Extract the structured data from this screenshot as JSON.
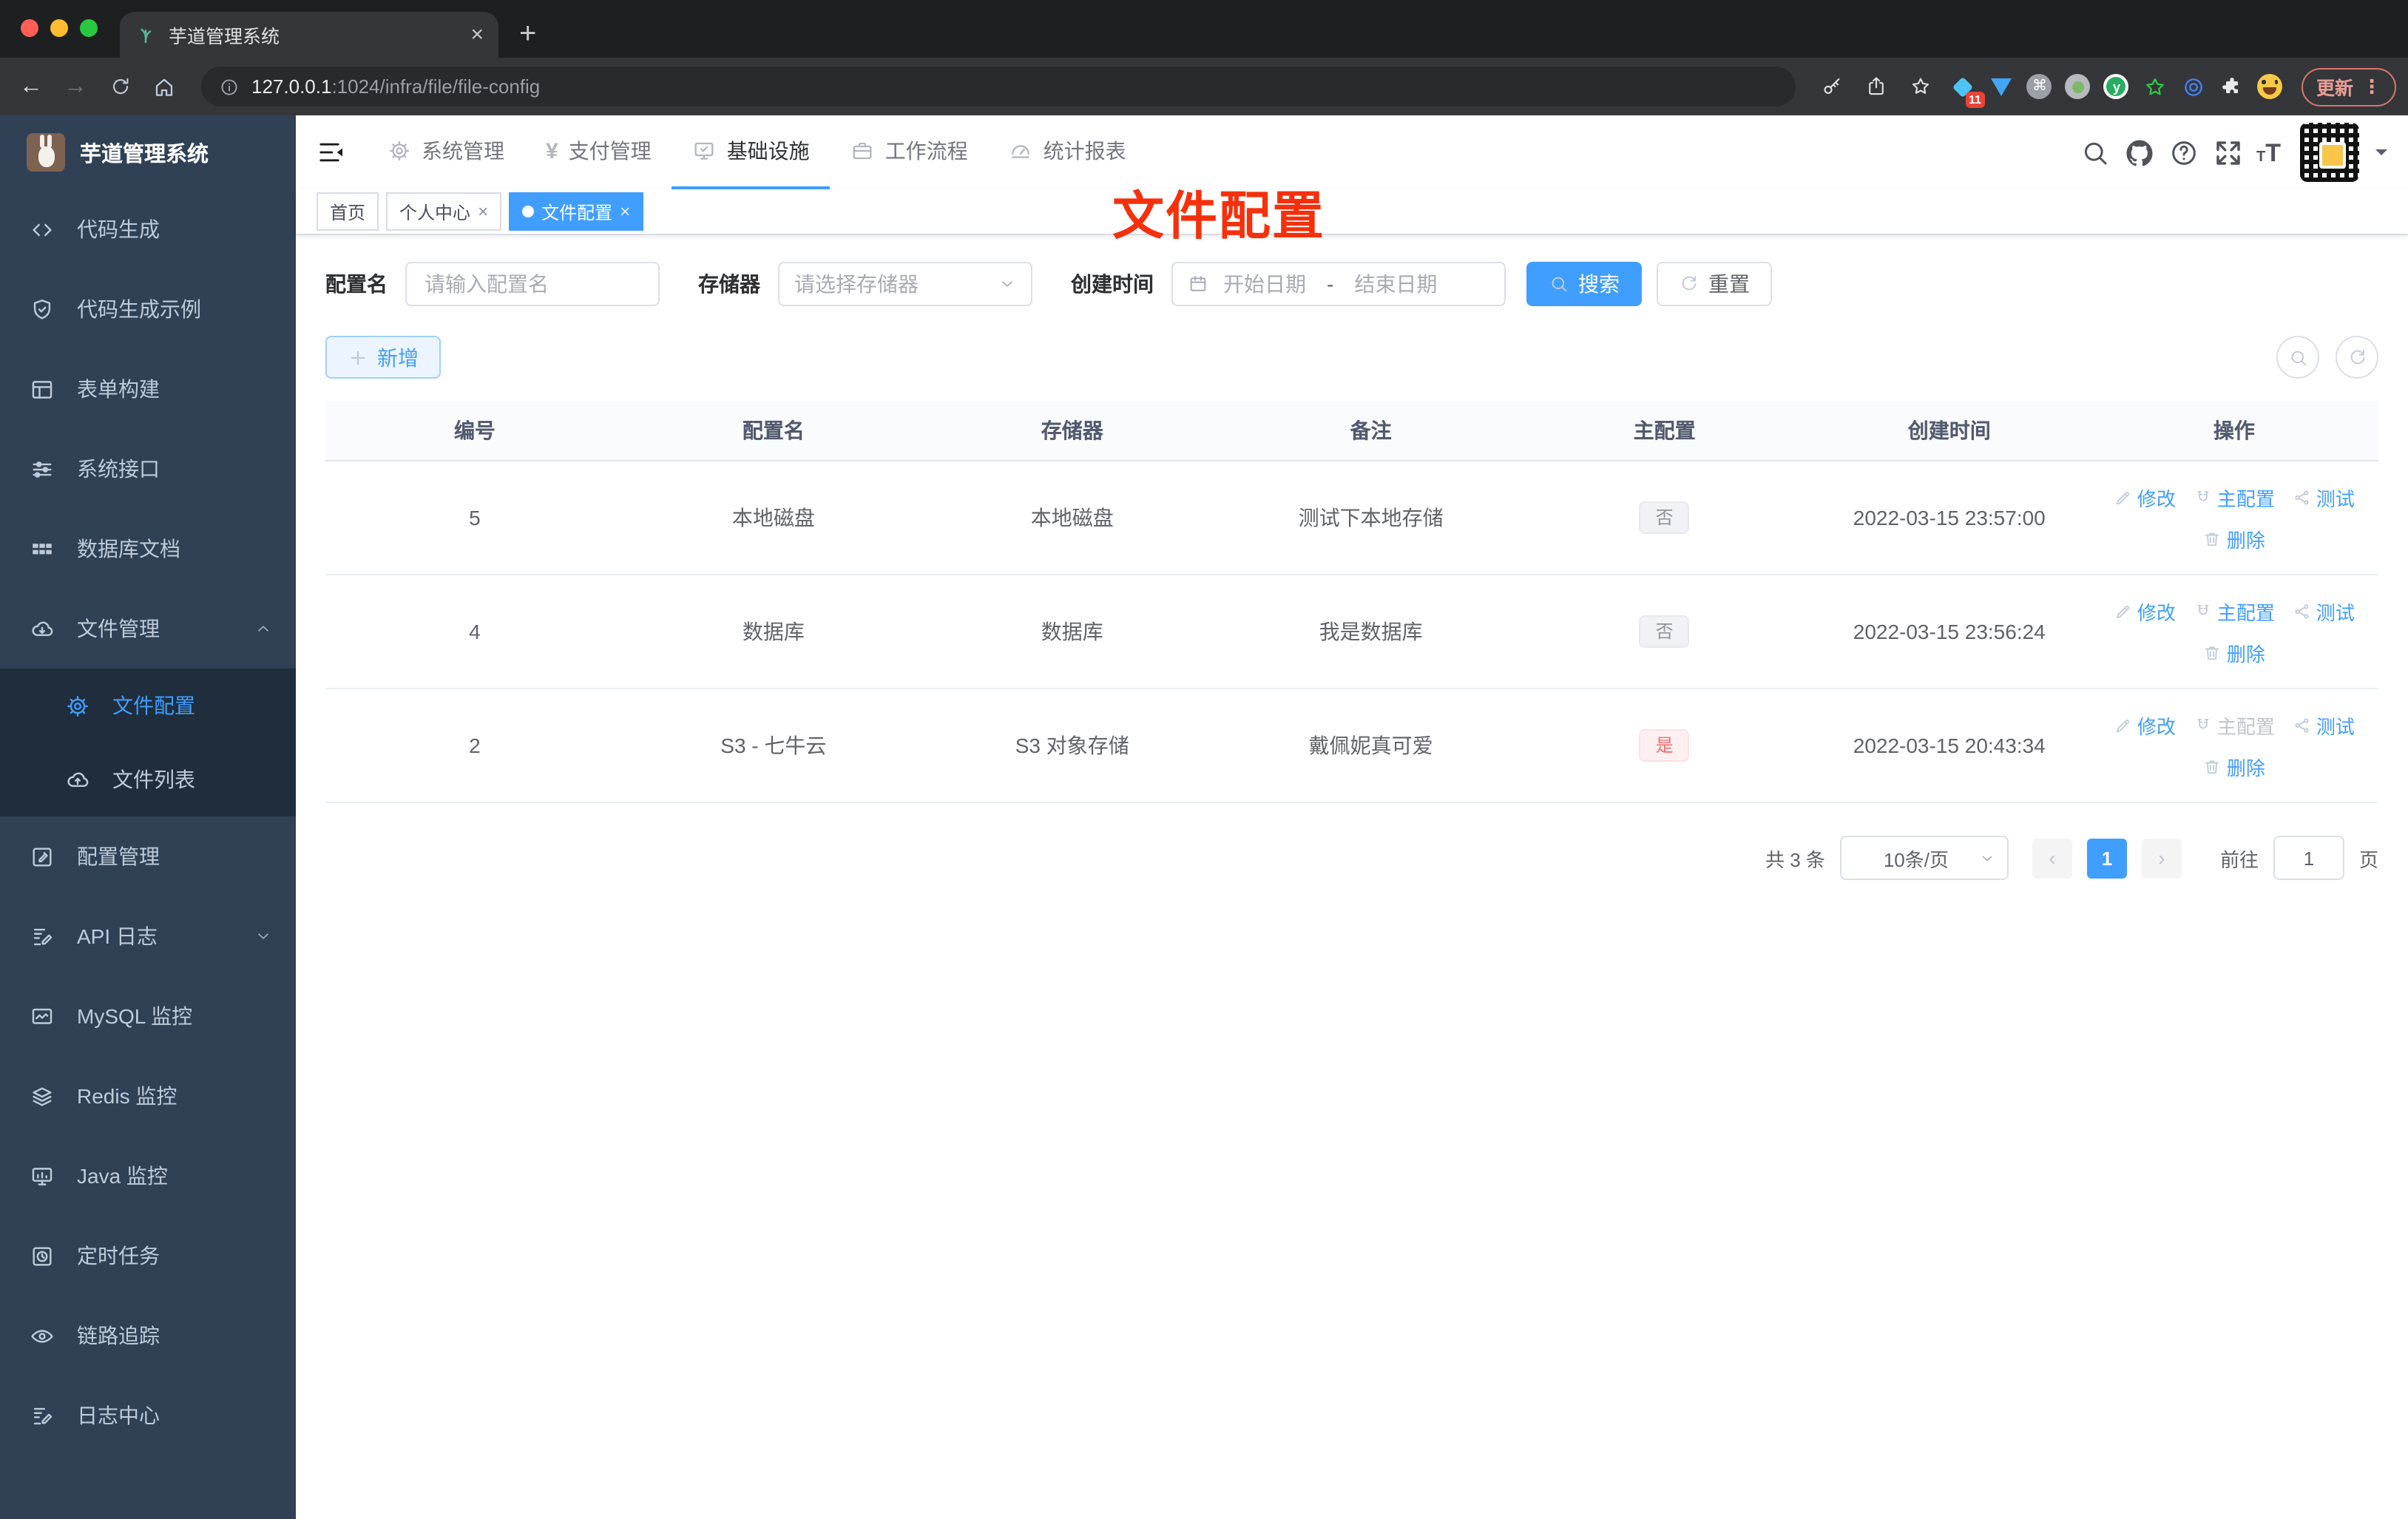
{
  "browser": {
    "tab_title": "芋道管理系统",
    "new_tab_label": "+",
    "url_host": "127.0.0.1",
    "url_path": ":1024/infra/file/file-config",
    "update_label": "更新",
    "extension_badge": "11",
    "traffic_lights": [
      "#ff5f57",
      "#febc2e",
      "#28c840"
    ]
  },
  "sidebar": {
    "title": "芋道管理系统",
    "items": [
      {
        "label": "代码生成",
        "icon": "code-icon"
      },
      {
        "label": "代码生成示例",
        "icon": "shield-check-icon"
      },
      {
        "label": "表单构建",
        "icon": "form-icon"
      },
      {
        "label": "系统接口",
        "icon": "sliders-icon"
      },
      {
        "label": "数据库文档",
        "icon": "grid-icon"
      },
      {
        "label": "文件管理",
        "icon": "cloud-download-icon",
        "expanded": true,
        "children": [
          {
            "label": "文件配置",
            "icon": "gear-icon",
            "active": true
          },
          {
            "label": "文件列表",
            "icon": "cloud-upload-icon"
          }
        ]
      },
      {
        "label": "配置管理",
        "icon": "edit-square-icon"
      },
      {
        "label": "API 日志",
        "icon": "doc-edit-icon",
        "collapsed": true
      },
      {
        "label": "MySQL 监控",
        "icon": "chart-icon"
      },
      {
        "label": "Redis 监控",
        "icon": "layers-icon"
      },
      {
        "label": "Java 监控",
        "icon": "monitor-icon"
      },
      {
        "label": "定时任务",
        "icon": "timer-icon"
      },
      {
        "label": "链路追踪",
        "icon": "eye-icon"
      },
      {
        "label": "日志中心",
        "icon": "doc-edit-icon"
      }
    ]
  },
  "header": {
    "nav": [
      {
        "label": "系统管理",
        "icon": "gear-icon"
      },
      {
        "label": "支付管理",
        "icon": "yen-icon"
      },
      {
        "label": "基础设施",
        "icon": "monitor-check-icon",
        "active": true
      },
      {
        "label": "工作流程",
        "icon": "briefcase-icon"
      },
      {
        "label": "统计报表",
        "icon": "gauge-icon"
      }
    ],
    "tools": [
      "search-icon",
      "github-icon",
      "help-icon",
      "fullscreen-icon",
      "font-size-icon",
      "avatar-qr",
      "caret-down-icon"
    ]
  },
  "tags": [
    {
      "label": "首页"
    },
    {
      "label": "个人中心",
      "closable": true
    },
    {
      "label": "文件配置",
      "active": true,
      "closable": true
    }
  ],
  "annotation": {
    "text": "文件配置",
    "color": "#f6300c"
  },
  "filters": {
    "name_label": "配置名",
    "name_placeholder": "请输入配置名",
    "storage_label": "存储器",
    "storage_placeholder": "请选择存储器",
    "time_label": "创建时间",
    "start_placeholder": "开始日期",
    "range_separator": "-",
    "end_placeholder": "结束日期",
    "search_label": "搜索",
    "reset_label": "重置",
    "add_label": "新增"
  },
  "table": {
    "headers": [
      "编号",
      "配置名",
      "存储器",
      "备注",
      "主配置",
      "创建时间",
      "操作"
    ],
    "action_labels": {
      "edit": "修改",
      "master": "主配置",
      "test": "测试",
      "del": "删除"
    },
    "rows": [
      {
        "id": "5",
        "name": "本地磁盘",
        "storage": "本地磁盘",
        "remark": "测试下本地存储",
        "master": "否",
        "master_type": "info",
        "time": "2022-03-15 23:57:00",
        "master_action_disabled": false
      },
      {
        "id": "4",
        "name": "数据库",
        "storage": "数据库",
        "remark": "我是数据库",
        "master": "否",
        "master_type": "info",
        "time": "2022-03-15 23:56:24",
        "master_action_disabled": false
      },
      {
        "id": "2",
        "name": "S3 - 七牛云",
        "storage": "S3 对象存储",
        "remark": "戴佩妮真可爱",
        "master": "是",
        "master_type": "danger",
        "time": "2022-03-15 20:43:34",
        "master_action_disabled": true
      }
    ]
  },
  "pagination": {
    "total_text": "共 3 条",
    "page_size": "10条/页",
    "prev": "‹",
    "current": "1",
    "next": "›",
    "goto_label": "前往",
    "goto_value": "1",
    "page_suffix": "页"
  },
  "colors": {
    "primary": "#409eff",
    "sidebar_bg": "#304156",
    "submenu_bg": "#1f2d3d",
    "sidebar_text": "#bfcbd9",
    "danger_text": "#f56c6c",
    "annotation_red": "#f6300c",
    "tag_active_bg": "#409eff"
  }
}
